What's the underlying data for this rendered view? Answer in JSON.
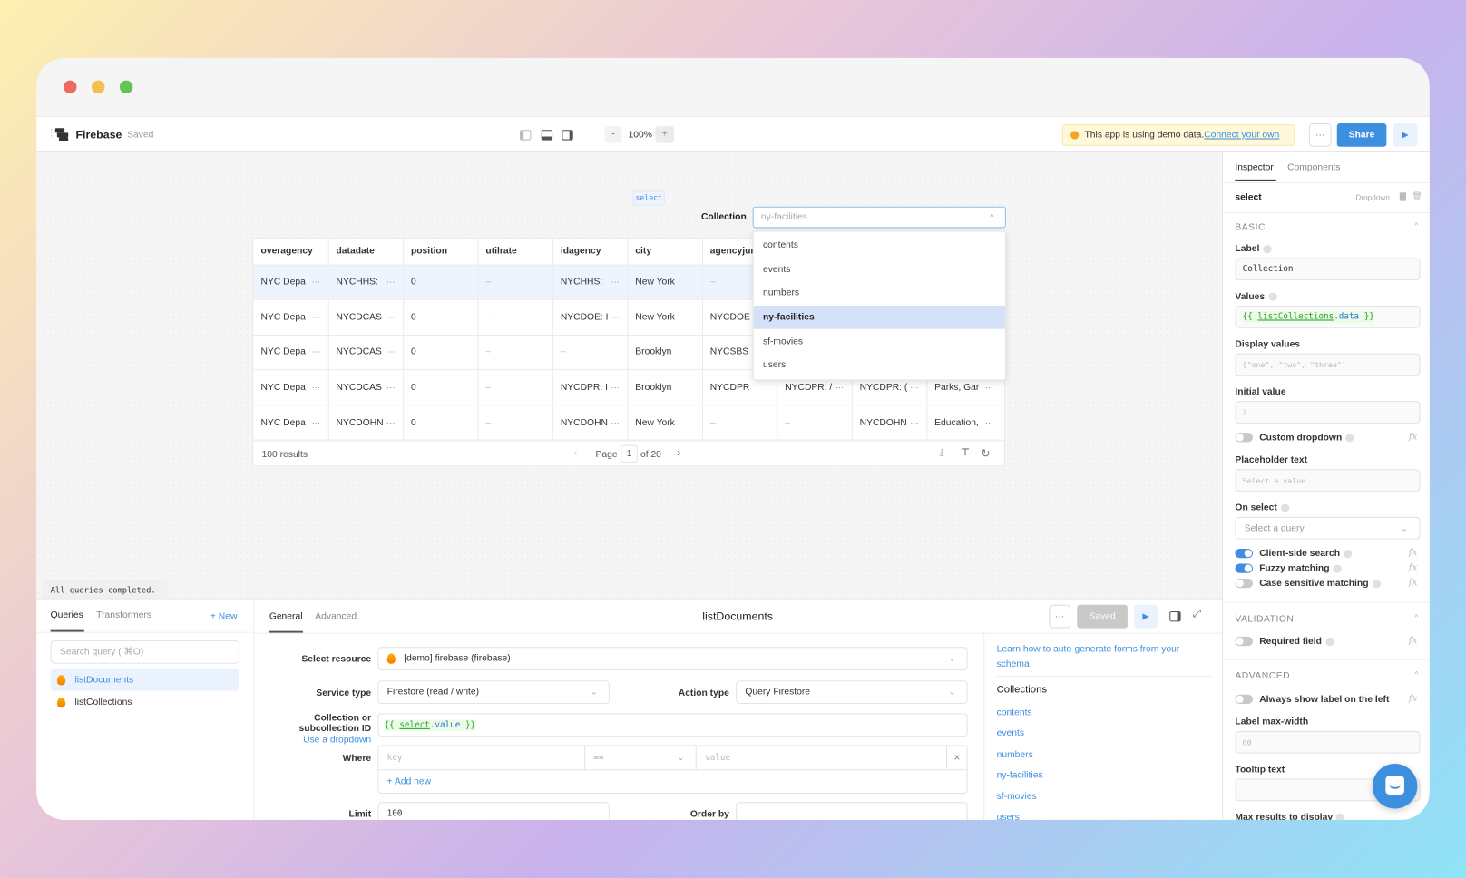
{
  "header": {
    "app_name": "Firebase",
    "save_status": "Saved",
    "zoom": "100%",
    "zoom_out": "-",
    "zoom_in": "+",
    "demo_notice": "This app is using demo data.",
    "demo_link": "Connect your own",
    "more": "···",
    "share": "Share"
  },
  "canvas": {
    "component_tag": "select",
    "select": {
      "label": "Collection",
      "value": "ny-facilities",
      "options": [
        "contents",
        "events",
        "numbers",
        "ny-facilities",
        "sf-movies",
        "users"
      ],
      "highlighted": "ny-facilities"
    },
    "table": {
      "columns": [
        "overagency",
        "datadate",
        "position",
        "utilrate",
        "idagency",
        "city",
        "agencyjuri",
        "",
        "",
        ""
      ],
      "rows": [
        [
          "NYC Depa",
          "NYCHHS:",
          "0",
          "–",
          "NYCHHS:",
          "New York",
          "–",
          "",
          "",
          ""
        ],
        [
          "NYC Depa",
          "NYCDCAS",
          "0",
          "–",
          "NYCDOE: I",
          "New York",
          "NYCDOE",
          "",
          "",
          ""
        ],
        [
          "NYC Depa",
          "NYCDCAS",
          "0",
          "–",
          "–",
          "Brooklyn",
          "NYCSBS",
          "",
          "",
          ""
        ],
        [
          "NYC Depa",
          "NYCDCAS",
          "0",
          "–",
          "NYCDPR: I",
          "Brooklyn",
          "NYCDPR",
          "NYCDPR: /",
          "NYCDPR: (",
          "Parks, Gar"
        ],
        [
          "NYC Depa",
          "NYCDOHN",
          "0",
          "–",
          "NYCDOHN",
          "New York",
          "–",
          "–",
          "NYCDOHN",
          "Education,"
        ]
      ],
      "results": "100 results",
      "page_label": "Page",
      "page": "1",
      "page_of": "of 20"
    },
    "status": "All queries completed."
  },
  "inspector": {
    "tabs": [
      "Inspector",
      "Components"
    ],
    "component_name": "select",
    "component_type": "Dropdown",
    "basic": "BASIC",
    "label_label": "Label",
    "label_value": "Collection",
    "values_label": "Values",
    "values_open": "{{ ",
    "values_ref": "listCollections",
    "values_prop": ".data",
    "values_close": " }}",
    "display_label": "Display values",
    "display_placeholder": "[\"one\", \"two\", \"three\"]",
    "initial_label": "Initial value",
    "initial_placeholder": "3",
    "custom_dropdown": "Custom dropdown",
    "placeholder_label": "Placeholder text",
    "placeholder_placeholder": "Select a value",
    "onselect_label": "On select",
    "onselect_placeholder": "Select a query",
    "client_search": "Client-side search",
    "fuzzy": "Fuzzy matching",
    "case_sensitive": "Case sensitive matching",
    "toggles": {
      "custom_dropdown": false,
      "client_search": true,
      "fuzzy": true,
      "case_sensitive": false,
      "required": false,
      "label_left": false
    },
    "validation": "VALIDATION",
    "required": "Required field",
    "advanced": "ADVANCED",
    "label_left": "Always show label on the left",
    "max_width_label": "Label max-width",
    "max_width_placeholder": "60",
    "tooltip_label": "Tooltip text",
    "max_results_label": "Max results to display",
    "fx": "fx"
  },
  "queries": {
    "tabs": [
      "Queries",
      "Transformers"
    ],
    "new": "+ New",
    "search_placeholder": "Search query ( ⌘O)",
    "items": [
      "listDocuments",
      "listCollections"
    ]
  },
  "editor": {
    "tabs": [
      "General",
      "Advanced"
    ],
    "title": "listDocuments",
    "more": "···",
    "saved": "Saved",
    "select_resource_label": "Select resource",
    "resource": "[demo] firebase (firebase)",
    "service_type_label": "Service type",
    "service_type": "Firestore (read / write)",
    "action_type_label": "Action type",
    "action_type": "Query Firestore",
    "collection_label_1": "Collection or",
    "collection_label_2": "subcollection ID",
    "use_dropdown": "Use a dropdown",
    "collection_open": "{{ ",
    "collection_ref": "select",
    "collection_prop": ".value",
    "collection_close": " }}",
    "where_label": "Where",
    "key_placeholder": "key",
    "operator": "==",
    "value_placeholder": "value",
    "add_new": "+ Add new",
    "limit_label": "Limit",
    "limit": "100",
    "order_by_label": "Order by"
  },
  "side": {
    "learn_link": "Learn how to auto-generate forms from your schema",
    "collections_title": "Collections",
    "collections": [
      "contents",
      "events",
      "numbers",
      "ny-facilities",
      "sf-movies",
      "users"
    ]
  },
  "colors": {
    "accent": "#3d8fe0",
    "highlight": "#d5e1f8",
    "warning_bg": "#fff8d9"
  }
}
